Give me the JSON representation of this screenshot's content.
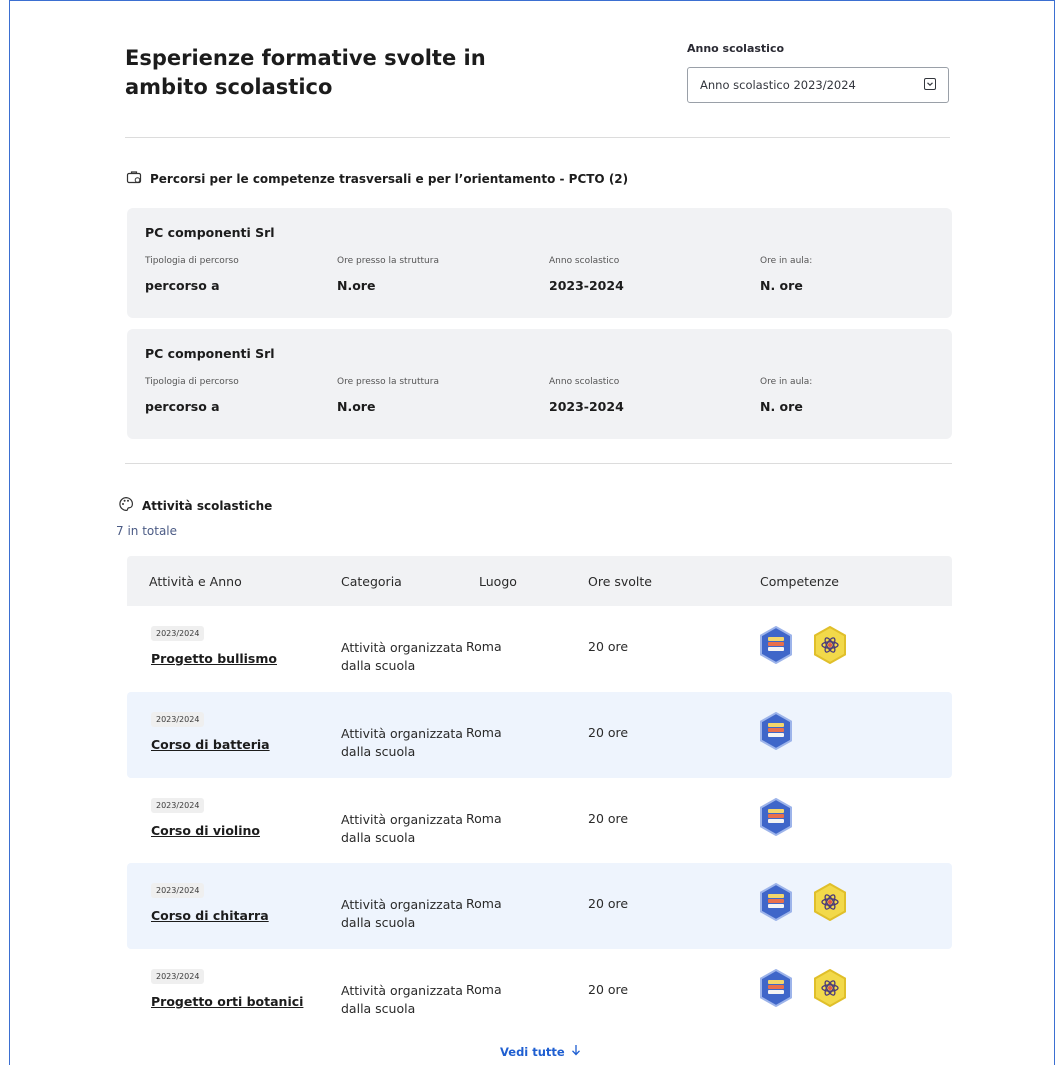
{
  "header": {
    "title": "Esperienze formative svolte in ambito scolastico",
    "select_label": "Anno scolastico",
    "select_value": "Anno scolastico 2023/2024"
  },
  "pcto": {
    "heading": "Percorsi per le competenze trasversali e per l’orientamento - PCTO (2)",
    "cards": [
      {
        "name": "PC componenti Srl",
        "tipologia_label": "Tipologia di percorso",
        "tipologia": "percorso a",
        "ore_struttura_label": "Ore presso la struttura",
        "ore_struttura": "N.ore",
        "anno_label": "Anno scolastico",
        "anno": "2023-2024",
        "ore_aula_label": "Ore in aula:",
        "ore_aula": "N. ore"
      },
      {
        "name": "PC componenti Srl",
        "tipologia_label": "Tipologia di percorso",
        "tipologia": "percorso a",
        "ore_struttura_label": "Ore presso la struttura",
        "ore_struttura": "N.ore",
        "anno_label": "Anno scolastico",
        "anno": "2023-2024",
        "ore_aula_label": "Ore in aula:",
        "ore_aula": "N. ore"
      }
    ]
  },
  "attivita": {
    "heading": "Attività scolastiche",
    "count": "7 in totale",
    "columns": [
      "Attività e Anno",
      "Categoria",
      "Luogo",
      "Ore svolte",
      "Competenze"
    ],
    "rows": [
      {
        "year": "2023/2024",
        "name": "Progetto bullismo",
        "categoria": "Attività organizzata dalla scuola",
        "luogo": "Roma",
        "ore": "20 ore",
        "badges": [
          "blue",
          "yellow"
        ]
      },
      {
        "year": "2023/2024",
        "name": "Corso di batteria",
        "categoria": "Attività organizzata dalla scuola",
        "luogo": "Roma",
        "ore": "20 ore",
        "badges": [
          "blue"
        ]
      },
      {
        "year": "2023/2024",
        "name": "Corso di violino",
        "categoria": "Attività organizzata dalla scuola",
        "luogo": "Roma",
        "ore": "20 ore",
        "badges": [
          "blue"
        ]
      },
      {
        "year": "2023/2024",
        "name": "Corso di chitarra",
        "categoria": "Attività organizzata dalla scuola",
        "luogo": "Roma",
        "ore": "20 ore",
        "badges": [
          "blue",
          "yellow"
        ]
      },
      {
        "year": "2023/2024",
        "name": "Progetto orti botanici",
        "categoria": "Attività organizzata dalla scuola",
        "luogo": "Roma",
        "ore": "20 ore",
        "badges": [
          "blue",
          "yellow"
        ]
      }
    ],
    "more_label": "Vedi tutte",
    "more_icon": "arrow-down-icon"
  },
  "colors": {
    "accent": "#1f5fd1",
    "frame": "#3b6fd1",
    "card_bg": "#f1f2f4",
    "row_alt": "#eef4fd",
    "badge_blue": "#5b86e5",
    "badge_yellow": "#f2d94a"
  }
}
